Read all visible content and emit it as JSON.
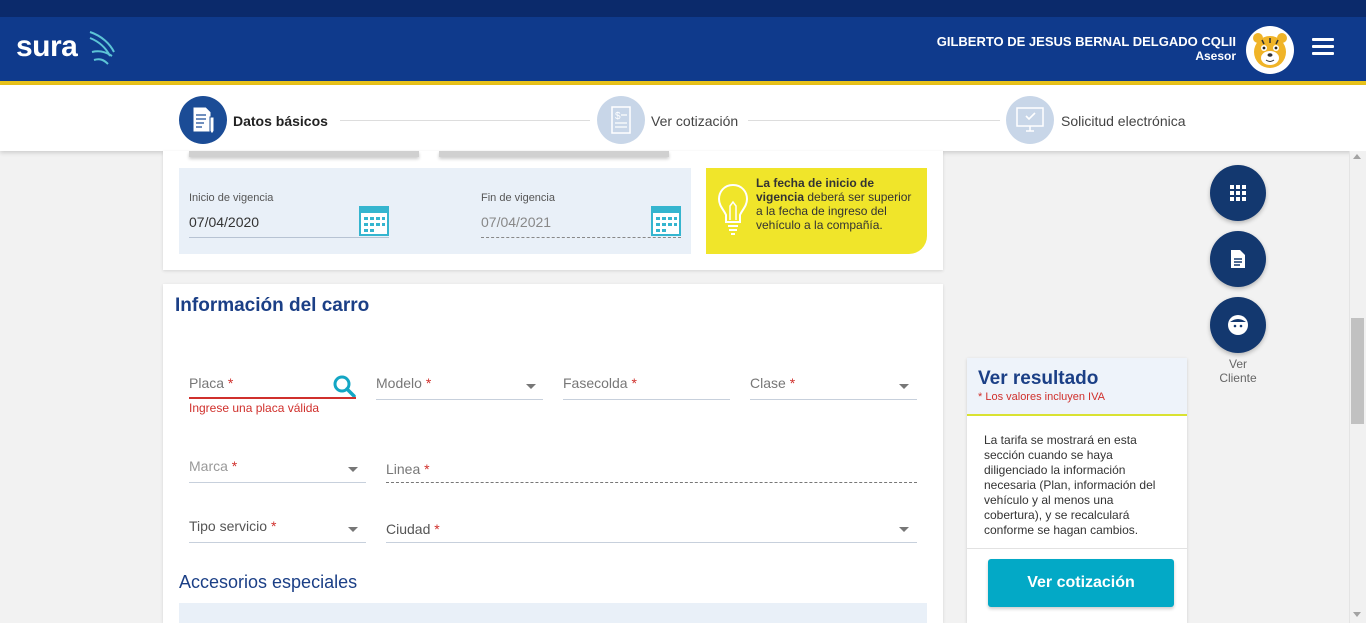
{
  "header": {
    "logo_text": "sura",
    "user_name": "GILBERTO DE JESUS BERNAL DELGADO CQLII",
    "user_role": "Asesor"
  },
  "stepper": {
    "steps": [
      {
        "label": "Datos básicos",
        "icon": "document-icon",
        "active": true
      },
      {
        "label": "Ver cotización",
        "icon": "invoice-icon",
        "active": false
      },
      {
        "label": "Solicitud electrónica",
        "icon": "monitor-check-icon",
        "active": false
      }
    ]
  },
  "vigencia": {
    "inicio_label": "Inicio de vigencia",
    "inicio_value": "07/04/2020",
    "fin_label": "Fin de vigencia",
    "fin_value": "07/04/2021"
  },
  "notice": {
    "bold": "La fecha de inicio de vigencia",
    "text": " deberá ser superior a la fecha de ingreso del vehículo a la compañía."
  },
  "car_info": {
    "title": "Información del carro",
    "fields": {
      "placa": "Placa",
      "placa_error": "Ingrese una placa válida",
      "modelo": "Modelo",
      "fasecolda": "Fasecolda",
      "clase": "Clase",
      "marca": "Marca",
      "linea": "Linea",
      "tipo_servicio": "Tipo servicio",
      "ciudad": "Ciudad"
    },
    "required_mark": "*",
    "accesorios_title": "Accesorios especiales"
  },
  "side_actions": {
    "ver_cliente_label": "Ver Cliente"
  },
  "result": {
    "title": "Ver resultado",
    "subtitle": "* Los valores incluyen IVA",
    "body": "La tarifa se mostrará en esta sección cuando se haya diligenciado la información necesaria (Plan, información del vehículo y al menos una cobertura), y se recalculará conforme se hagan cambios.",
    "button_label": "Ver cotización"
  },
  "colors": {
    "primary": "#0f3a8c",
    "gold": "#e8c21a",
    "accent": "#03a9c6",
    "error": "#d0302c",
    "notice": "#f0e52a"
  }
}
